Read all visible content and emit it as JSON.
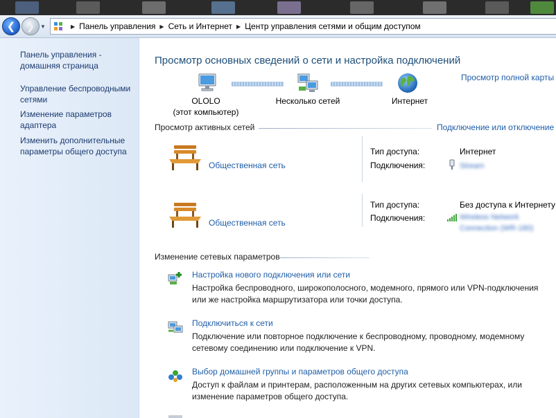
{
  "address_bar": {
    "crumbs": [
      "Панель управления",
      "Сеть и Интернет",
      "Центр управления сетями и общим доступом"
    ]
  },
  "sidebar": {
    "items": [
      {
        "label": "Панель управления - домашняя страница"
      },
      {
        "label": "Управление беспроводными сетями"
      },
      {
        "label": "Изменение параметров адаптера"
      },
      {
        "label": "Изменить дополнительные параметры общего доступа"
      }
    ]
  },
  "main": {
    "title": "Просмотр основных сведений о сети и настройка подключений",
    "full_map_link": "Просмотр полной карты",
    "map": {
      "computer_name": "OLOLO",
      "computer_sub": "(этот компьютер)",
      "networks_label": "Несколько сетей",
      "internet_label": "Интернет"
    },
    "active_section": {
      "title": "Просмотр активных сетей",
      "connect_link": "Подключение или отключение"
    },
    "networks": [
      {
        "name": "Общественная сеть",
        "access_key": "Тип доступа:",
        "access_value": "Интернет",
        "conn_key": "Подключения:",
        "conn_value": "Stream"
      },
      {
        "name": "Общественная сеть",
        "access_key": "Тип доступа:",
        "access_value": "Без доступа к Интернету",
        "conn_key": "Подключения:",
        "conn_value_line1": "Wireless Network",
        "conn_value_line2": "Connection (WR-180)"
      }
    ],
    "change_section": {
      "title": "Изменение сетевых параметров"
    },
    "tasks": [
      {
        "link": "Настройка нового подключения или сети",
        "desc": "Настройка беспроводного, широкополосного, модемного, прямого или VPN-подключения или же настройка маршрутизатора или точки доступа."
      },
      {
        "link": "Подключиться к сети",
        "desc": "Подключение или повторное подключение к беспроводному, проводному, модемному сетевому соединению или подключение к VPN."
      },
      {
        "link": "Выбор домашней группы и параметров общего доступа",
        "desc": "Доступ к файлам и принтерам, расположенным на других сетевых компьютерах, или изменение параметров общего доступа."
      }
    ]
  }
}
